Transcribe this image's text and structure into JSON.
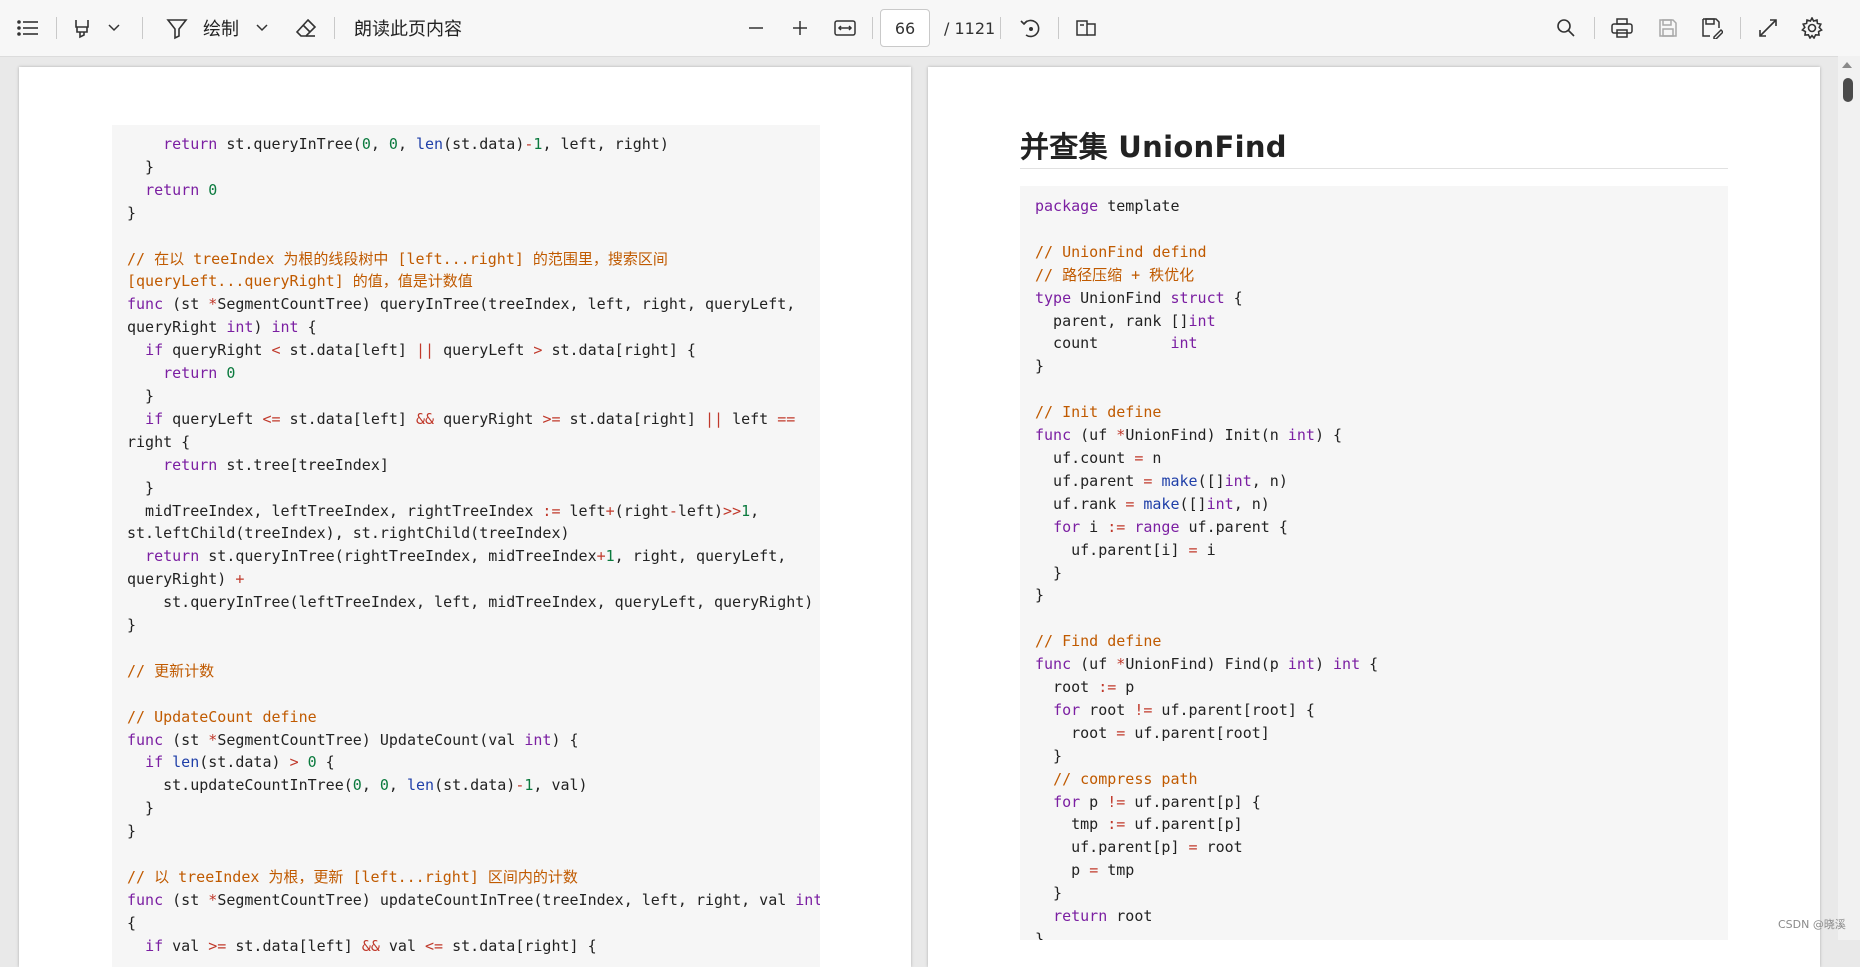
{
  "toolbar": {
    "draw_label": "绘制",
    "read_aloud_label": "朗读此页内容",
    "page_number": "66",
    "page_total": "/ 1121"
  },
  "left_page": {
    "code": "    return st.queryInTree(0, 0, len(st.data)-1, left, right)\n  }\n  return 0\n}\n\n// 在以 treeIndex 为根的线段树中 [left...right] 的范围里，搜索区间\n[queryLeft...queryRight] 的值，值是计数值\nfunc (st *SegmentCountTree) queryInTree(treeIndex, left, right, queryLeft,\nqueryRight int) int {\n  if queryRight < st.data[left] || queryLeft > st.data[right] {\n    return 0\n  }\n  if queryLeft <= st.data[left] && queryRight >= st.data[right] || left ==\nright {\n    return st.tree[treeIndex]\n  }\n  midTreeIndex, leftTreeIndex, rightTreeIndex := left+(right-left)>>1,\nst.leftChild(treeIndex), st.rightChild(treeIndex)\n  return st.queryInTree(rightTreeIndex, midTreeIndex+1, right, queryLeft,\nqueryRight) +\n    st.queryInTree(leftTreeIndex, left, midTreeIndex, queryLeft, queryRight)\n}\n\n// 更新计数\n\n// UpdateCount define\nfunc (st *SegmentCountTree) UpdateCount(val int) {\n  if len(st.data) > 0 {\n    st.updateCountInTree(0, 0, len(st.data)-1, val)\n  }\n}\n\n// 以 treeIndex 为根，更新 [left...right] 区间内的计数\nfunc (st *SegmentCountTree) updateCountInTree(treeIndex, left, right, val int)\n{\n  if val >= st.data[left] && val <= st.data[right] {"
  },
  "right_page": {
    "heading": "并查集 UnionFind",
    "code": "package template\n\n// UnionFind defind\n// 路径压缩 + 秩优化\ntype UnionFind struct {\n  parent, rank []int\n  count        int\n}\n\n// Init define\nfunc (uf *UnionFind) Init(n int) {\n  uf.count = n\n  uf.parent = make([]int, n)\n  uf.rank = make([]int, n)\n  for i := range uf.parent {\n    uf.parent[i] = i\n  }\n}\n\n// Find define\nfunc (uf *UnionFind) Find(p int) int {\n  root := p\n  for root != uf.parent[root] {\n    root = uf.parent[root]\n  }\n  // compress path\n  for p != uf.parent[p] {\n    tmp := uf.parent[p]\n    uf.parent[p] = root\n    p = tmp\n  }\n  return root\n}"
  },
  "watermark": "CSDN @晓溪",
  "colors": {
    "keyword": "#7b1fa2",
    "comment": "#c05a00",
    "number": "#0b7a3e",
    "operator": "#c0392b",
    "builtin": "#1f3fa8",
    "code_bg": "#f6f6f6",
    "toolbar_bg": "#f7f7f7"
  }
}
